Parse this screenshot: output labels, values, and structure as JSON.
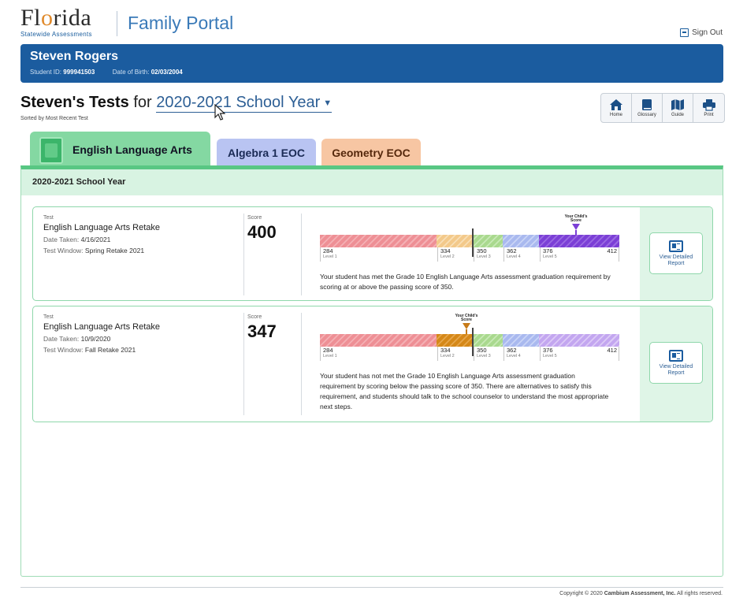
{
  "header": {
    "logo_text": "Florida",
    "logo_subtext": "Statewide Assessments",
    "portal_name": "Family Portal",
    "signout_label": "Sign Out"
  },
  "student": {
    "name": "Steven Rogers",
    "id_label": "Student ID:",
    "id_value": "999941503",
    "dob_label": "Date of Birth:",
    "dob_value": "02/03/2004"
  },
  "tests_header": {
    "title_bold": "Steven's Tests",
    "title_for": "for",
    "year_selected": "2020-2021 School Year",
    "sorted_text": "Sorted by Most Recent Test"
  },
  "toolbar": {
    "items": [
      {
        "label": "Home",
        "icon": "home-icon"
      },
      {
        "label": "Glossary",
        "icon": "glossary-icon"
      },
      {
        "label": "Guide",
        "icon": "guide-icon"
      },
      {
        "label": "Print",
        "icon": "print-icon"
      }
    ]
  },
  "tabs": [
    {
      "label": "English Language Arts",
      "active": true,
      "color": "#84d8a2"
    },
    {
      "label": "Algebra 1 EOC",
      "active": false,
      "color": "#b9c4f2"
    },
    {
      "label": "Geometry EOC",
      "active": false,
      "color": "#f7c6a3"
    }
  ],
  "panel": {
    "year_heading": "2020-2021 School Year"
  },
  "results": [
    {
      "test_label": "Test",
      "test_name": "English Language Arts Retake",
      "date_label": "Date Taken:",
      "date_value": "4/16/2021",
      "window_label": "Test Window:",
      "window_value": "Spring Retake 2021",
      "score_label": "Score",
      "score": "400",
      "marker_label": "Your Child's Score",
      "marker_level_color": "#7b3fd6",
      "scale_ticks": [
        {
          "value": "284",
          "level": "Level 1"
        },
        {
          "value": "334",
          "level": "Level 2"
        },
        {
          "value": "350",
          "level": "Level 3"
        },
        {
          "value": "362",
          "level": "Level 4"
        },
        {
          "value": "376",
          "level": "Level 5"
        }
      ],
      "scale_max": "412",
      "passing_score": 350,
      "description": "Your student has met the Grade 10 English Language Arts assessment graduation requirement by scoring at or above the passing score of 350.",
      "detail_label": "View Detailed Report"
    },
    {
      "test_label": "Test",
      "test_name": "English Language Arts Retake",
      "date_label": "Date Taken:",
      "date_value": "10/9/2020",
      "window_label": "Test Window:",
      "window_value": "Fall Retake 2021",
      "score_label": "Score",
      "score": "347",
      "marker_label": "Your Child's Score",
      "marker_level_color": "#c77b18",
      "scale_ticks": [
        {
          "value": "284",
          "level": "Level 1"
        },
        {
          "value": "334",
          "level": "Level 2"
        },
        {
          "value": "350",
          "level": "Level 3"
        },
        {
          "value": "362",
          "level": "Level 4"
        },
        {
          "value": "376",
          "level": "Level 5"
        }
      ],
      "scale_max": "412",
      "passing_score": 350,
      "description": "Your student has not met the Grade 10 English Language Arts assessment graduation requirement by scoring below the passing score of 350. There are alternatives to satisfy this requirement, and students should talk to the school counselor to understand the most appropriate next steps.",
      "detail_label": "View Detailed Report"
    }
  ],
  "level_colors": {
    "level1": "#ee8f95",
    "level2": "#f3c98a",
    "level3": "#a9d98e",
    "level4": "#a9b9ef",
    "level5": "#c3a6f0",
    "level5_active": "#7b3fd6",
    "level2_active": "#d58818"
  },
  "footer": {
    "copyright_prefix": "Copyright © 2020",
    "copyright_company": "Cambium Assessment, Inc.",
    "copyright_suffix": "All rights reserved."
  }
}
